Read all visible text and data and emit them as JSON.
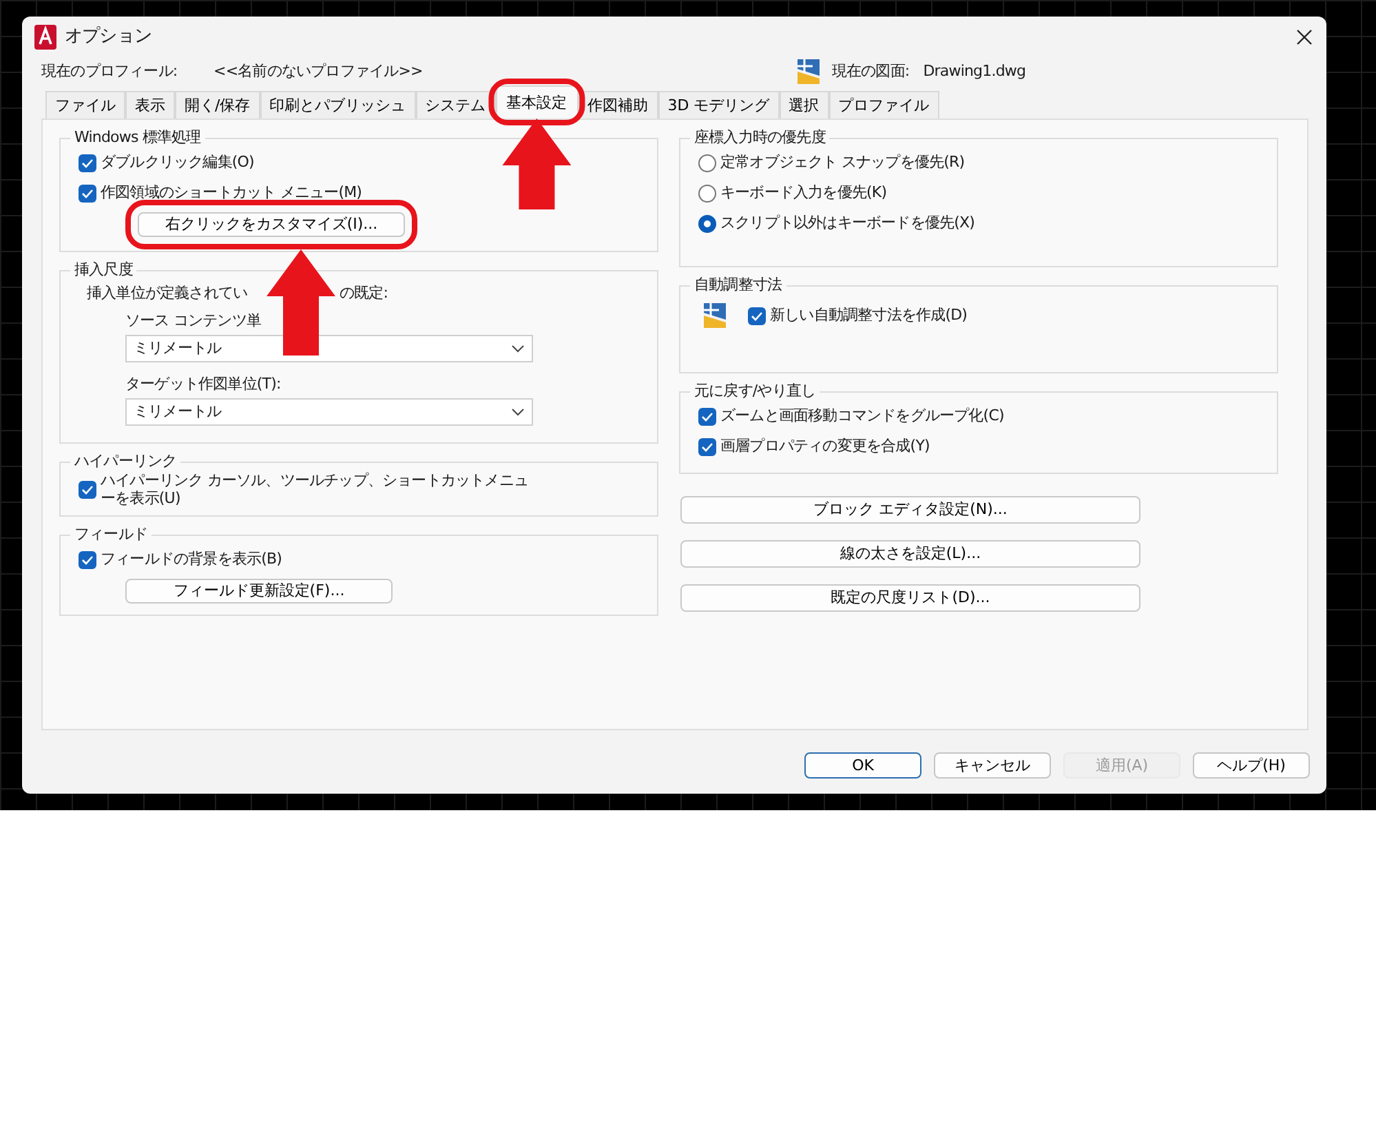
{
  "window": {
    "title": "オプション"
  },
  "profile": {
    "label": "現在のプロフィール:",
    "value": "<<名前のないプロファイル>>",
    "drawing_label": "現在の図面:",
    "drawing_value": "Drawing1.dwg"
  },
  "tabs": [
    {
      "label": "ファイル",
      "selected": false
    },
    {
      "label": "表示",
      "selected": false
    },
    {
      "label": "開く/保存",
      "selected": false
    },
    {
      "label": "印刷とパブリッシュ",
      "selected": false
    },
    {
      "label": "システム",
      "selected": false
    },
    {
      "label": "基本設定",
      "selected": true
    },
    {
      "label": "作図補助",
      "selected": false
    },
    {
      "label": "3D モデリング",
      "selected": false
    },
    {
      "label": "選択",
      "selected": false
    },
    {
      "label": "プロファイル",
      "selected": false
    }
  ],
  "left_groups": [
    {
      "title": "Windows 標準処理",
      "items": [
        {
          "kind": "checkbox",
          "label": "ダブルクリック編集(O)",
          "checked": true
        },
        {
          "kind": "checkbox",
          "label": "作図領域のショートカット メニュー(M)",
          "checked": true
        },
        {
          "kind": "button",
          "label": "右クリックをカスタマイズ(I)..."
        }
      ]
    },
    {
      "title": "挿入尺度",
      "items": [
        {
          "kind": "split_text",
          "parts": [
            "挿入単位が定義されてい",
            "の既定:"
          ]
        },
        {
          "kind": "field_label",
          "label": "ソース コンテンツ単"
        },
        {
          "kind": "dropdown",
          "value": "ミリメートル"
        },
        {
          "kind": "field_label",
          "label": "ターゲット作図単位(T):"
        },
        {
          "kind": "dropdown",
          "value": "ミリメートル"
        }
      ]
    },
    {
      "title": "ハイパーリンク",
      "items": [
        {
          "kind": "checkbox",
          "label": "ハイパーリンク カーソル、ツールチップ、ショートカットメニューを表示(U)",
          "checked": true
        }
      ]
    },
    {
      "title": "フィールド",
      "items": [
        {
          "kind": "checkbox",
          "label": "フィールドの背景を表示(B)",
          "checked": true
        },
        {
          "kind": "button",
          "label": "フィールド更新設定(F)..."
        }
      ]
    }
  ],
  "right_groups": [
    {
      "title": "座標入力時の優先度",
      "items": [
        {
          "kind": "radio",
          "label": "定常オブジェクト スナップを優先(R)",
          "selected": false
        },
        {
          "kind": "radio",
          "label": "キーボード入力を優先(K)",
          "selected": false
        },
        {
          "kind": "radio",
          "label": "スクリプト以外はキーボードを優先(X)",
          "selected": true
        }
      ]
    },
    {
      "title": "自動調整寸法",
      "items": [
        {
          "kind": "icon_checkbox",
          "label": "新しい自動調整寸法を作成(D)",
          "checked": true
        }
      ]
    },
    {
      "title": "元に戻す/やり直し",
      "items": [
        {
          "kind": "checkbox",
          "label": "ズームと画面移動コマンドをグループ化(C)",
          "checked": true
        },
        {
          "kind": "checkbox",
          "label": "画層プロパティの変更を合成(Y)",
          "checked": true
        }
      ]
    }
  ],
  "right_buttons": [
    "ブロック エディタ設定(N)...",
    "線の太さを設定(L)...",
    "既定の尺度リスト(D)..."
  ],
  "footer_buttons": [
    {
      "label": "OK",
      "focused": true,
      "disabled": false
    },
    {
      "label": "キャンセル",
      "focused": false,
      "disabled": false
    },
    {
      "label": "適用(A)",
      "focused": false,
      "disabled": true
    },
    {
      "label": "ヘルプ(H)",
      "focused": false,
      "disabled": false
    }
  ]
}
